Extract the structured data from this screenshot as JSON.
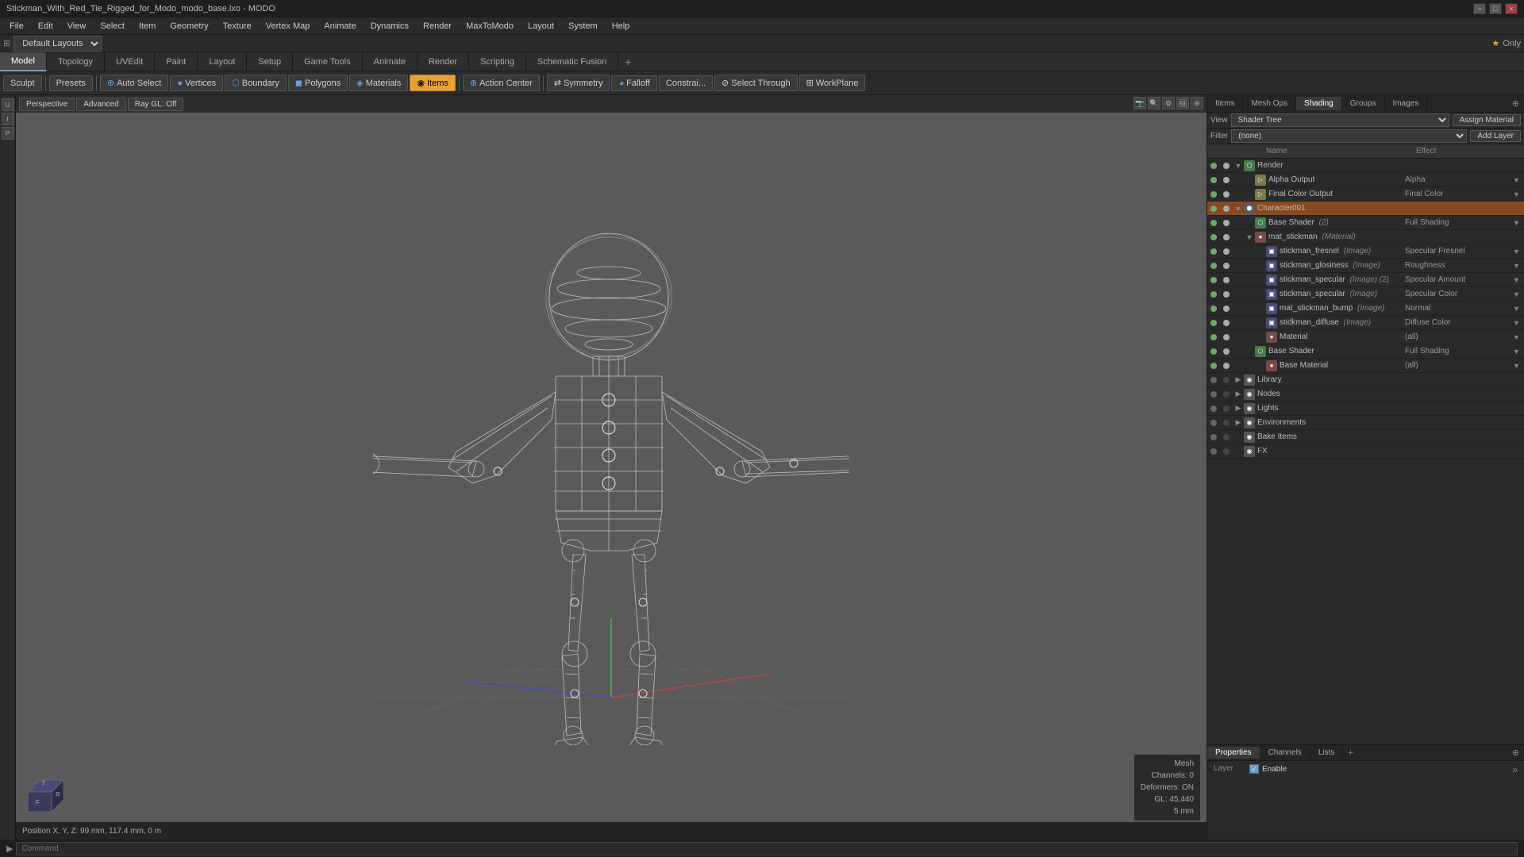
{
  "titleBar": {
    "title": "Stickman_With_Red_Tie_Rigged_for_Modo_modo_base.lxo - MODO",
    "minimizeLabel": "−",
    "maximizeLabel": "□",
    "closeLabel": "×"
  },
  "menuBar": {
    "items": [
      "File",
      "Edit",
      "View",
      "Select",
      "Item",
      "Geometry",
      "Texture",
      "Vertex Map",
      "Animate",
      "Dynamics",
      "Render",
      "MaxToModo",
      "Layout",
      "System",
      "Help"
    ]
  },
  "layoutBar": {
    "label": "Default Layouts",
    "rightLabel": "Only"
  },
  "tabs": {
    "items": [
      "Model",
      "Topology",
      "UVEdit",
      "Paint",
      "Layout",
      "Setup",
      "Game Tools",
      "Animate",
      "Render",
      "Scripting",
      "Schematic Fusion"
    ],
    "activeIndex": 0,
    "addLabel": "+"
  },
  "sculptBar": {
    "sculpt": "Sculpt",
    "presets": "Presets",
    "autoSelect": "Auto Select",
    "vertices": "Vertices",
    "boundary": "Boundary",
    "polygons": "Polygons",
    "materials": "Materials",
    "items": "Items",
    "actionCenter": "Action Center",
    "symmetry": "Symmetry",
    "falloff": "Falloff",
    "constrain": "Constrai...",
    "selectThrough": "Select Through",
    "workPlane": "WorkPlane"
  },
  "viewport": {
    "perspective": "Perspective",
    "advanced": "Advanced",
    "rayGL": "Ray GL: Off",
    "icons": [
      "🔍",
      "🔍",
      "⚙",
      "🖼",
      "⊕"
    ],
    "meshInfo": {
      "mesh": "Mesh",
      "channels": "Channels: 0",
      "deformers": "Deformers: ON",
      "gl": "GL: 45,440",
      "size": "5 mm"
    },
    "statusBar": "Position X, Y, Z:  99 mm, 117.4 mm, 0 m"
  },
  "rightPanel": {
    "tabs": [
      "Items",
      "Mesh Ops",
      "Shading",
      "Groups",
      "Images"
    ],
    "activeTab": "Shading",
    "tabEndLabel": "⊕",
    "shaderHeader": {
      "viewLabel": "View",
      "viewValue": "Shader Tree",
      "filterLabel": "Filter",
      "filterValue": "(none)",
      "assignMaterial": "Assign Material",
      "addLayer": "Add Layer"
    },
    "treeHeader": {
      "nameLabel": "Name",
      "effectLabel": "Effect"
    },
    "treeItems": [
      {
        "id": 0,
        "indent": 0,
        "expand": "▼",
        "iconType": "shader",
        "name": "Render",
        "tag": "",
        "effect": "",
        "vis": true,
        "renderVis": true
      },
      {
        "id": 1,
        "indent": 1,
        "expand": "",
        "iconType": "output",
        "name": "Alpha Output",
        "tag": "",
        "effect": "Alpha",
        "vis": true,
        "renderVis": true
      },
      {
        "id": 2,
        "indent": 1,
        "expand": "",
        "iconType": "output",
        "name": "Final Color Output",
        "tag": "",
        "effect": "Final Color",
        "vis": true,
        "renderVis": true
      },
      {
        "id": 3,
        "indent": 0,
        "expand": "▼",
        "iconType": "group",
        "name": "Character001",
        "tag": "",
        "effect": "",
        "vis": true,
        "renderVis": true,
        "highlighted": true
      },
      {
        "id": 4,
        "indent": 1,
        "expand": "",
        "iconType": "shader",
        "name": "Base Shader",
        "tag": "(2)",
        "effect": "Full Shading",
        "vis": true,
        "renderVis": true
      },
      {
        "id": 5,
        "indent": 1,
        "expand": "▼",
        "iconType": "material",
        "name": "mat_stickman",
        "tag": "(Material)",
        "effect": "",
        "vis": true,
        "renderVis": true
      },
      {
        "id": 6,
        "indent": 2,
        "expand": "",
        "iconType": "image",
        "name": "stickman_fresnel",
        "tag": "(Image)",
        "effect": "Specular Fresnel",
        "vis": true,
        "renderVis": true
      },
      {
        "id": 7,
        "indent": 2,
        "expand": "",
        "iconType": "image",
        "name": "stickman_glosiness",
        "tag": "(Image)",
        "effect": "Roughness",
        "vis": true,
        "renderVis": true
      },
      {
        "id": 8,
        "indent": 2,
        "expand": "",
        "iconType": "image",
        "name": "stickman_specular",
        "tag": "(Image) (2)",
        "effect": "Specular Amount",
        "vis": true,
        "renderVis": true
      },
      {
        "id": 9,
        "indent": 2,
        "expand": "",
        "iconType": "image",
        "name": "stickman_specular",
        "tag": "(Image)",
        "effect": "Specular Color",
        "vis": true,
        "renderVis": true
      },
      {
        "id": 10,
        "indent": 2,
        "expand": "",
        "iconType": "image",
        "name": "mat_stickman_bump",
        "tag": "(Image)",
        "effect": "Normal",
        "vis": true,
        "renderVis": true
      },
      {
        "id": 11,
        "indent": 2,
        "expand": "",
        "iconType": "image",
        "name": "stidkman_diffuse",
        "tag": "(Image)",
        "effect": "Diffuse Color",
        "vis": true,
        "renderVis": true
      },
      {
        "id": 12,
        "indent": 2,
        "expand": "",
        "iconType": "material",
        "name": "Material",
        "tag": "",
        "effect": "(all)",
        "vis": true,
        "renderVis": true
      },
      {
        "id": 13,
        "indent": 1,
        "expand": "",
        "iconType": "shader",
        "name": "Base Shader",
        "tag": "",
        "effect": "Full Shading",
        "vis": true,
        "renderVis": true
      },
      {
        "id": 14,
        "indent": 2,
        "expand": "",
        "iconType": "material",
        "name": "Base Material",
        "tag": "",
        "effect": "(all)",
        "vis": true,
        "renderVis": true
      },
      {
        "id": 15,
        "indent": 0,
        "expand": "▶",
        "iconType": "library",
        "name": "Library",
        "tag": "",
        "effect": "",
        "vis": false,
        "renderVis": false
      },
      {
        "id": 16,
        "indent": 0,
        "expand": "▶",
        "iconType": "library",
        "name": "Nodes",
        "tag": "",
        "effect": "",
        "vis": false,
        "renderVis": false
      },
      {
        "id": 17,
        "indent": 0,
        "expand": "▶",
        "iconType": "library",
        "name": "Lights",
        "tag": "",
        "effect": "",
        "vis": false,
        "renderVis": false
      },
      {
        "id": 18,
        "indent": 0,
        "expand": "▶",
        "iconType": "library",
        "name": "Environments",
        "tag": "",
        "effect": "",
        "vis": false,
        "renderVis": false
      },
      {
        "id": 19,
        "indent": 0,
        "expand": "",
        "iconType": "library",
        "name": "Bake Items",
        "tag": "",
        "effect": "",
        "vis": false,
        "renderVis": false
      },
      {
        "id": 20,
        "indent": 0,
        "expand": "",
        "iconType": "library",
        "name": "FX",
        "tag": "",
        "effect": "",
        "vis": false,
        "renderVis": false
      }
    ]
  },
  "bottomPanel": {
    "tabs": [
      "Properties",
      "Channels",
      "Lists"
    ],
    "addLabel": "+",
    "activeTab": "Properties",
    "layerLabel": "Layer",
    "enableLabel": "Enable",
    "arrowLabel": "»"
  },
  "commandBar": {
    "placeholder": "Command",
    "label": "▶"
  }
}
